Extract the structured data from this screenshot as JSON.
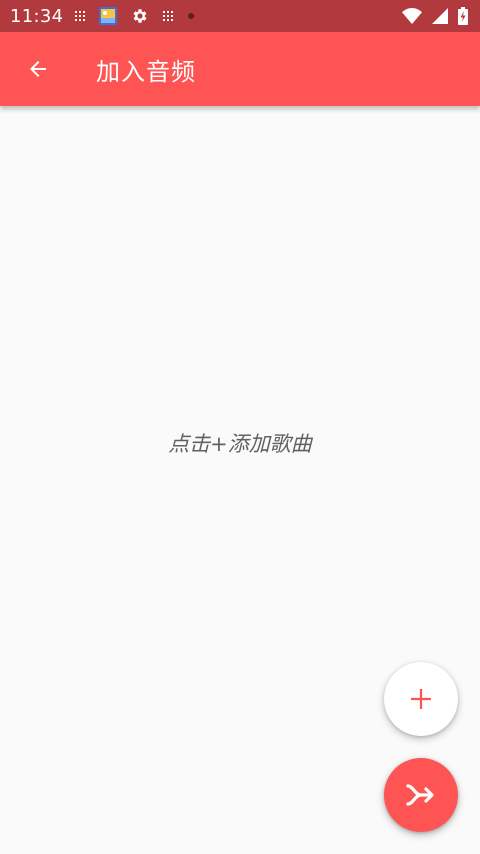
{
  "status_bar": {
    "time": "11:34",
    "icons_left": [
      "grid-notification-icon",
      "photo-app-icon",
      "gear-icon",
      "grid-notification-icon",
      "dot-icon"
    ],
    "icons_right": [
      "wifi-icon",
      "cell-signal-icon",
      "battery-charging-icon"
    ]
  },
  "app_bar": {
    "title": "加入音频",
    "back_icon": "arrow-back-icon"
  },
  "content": {
    "empty_hint": "点击+添加歌曲"
  },
  "fabs": {
    "add_icon": "plus-icon",
    "merge_icon": "merge-arrow-icon"
  },
  "colors": {
    "accent": "#FF5454",
    "status_bar": "#B23A3E",
    "background": "#FAFAFA",
    "hint_text": "#616161"
  }
}
